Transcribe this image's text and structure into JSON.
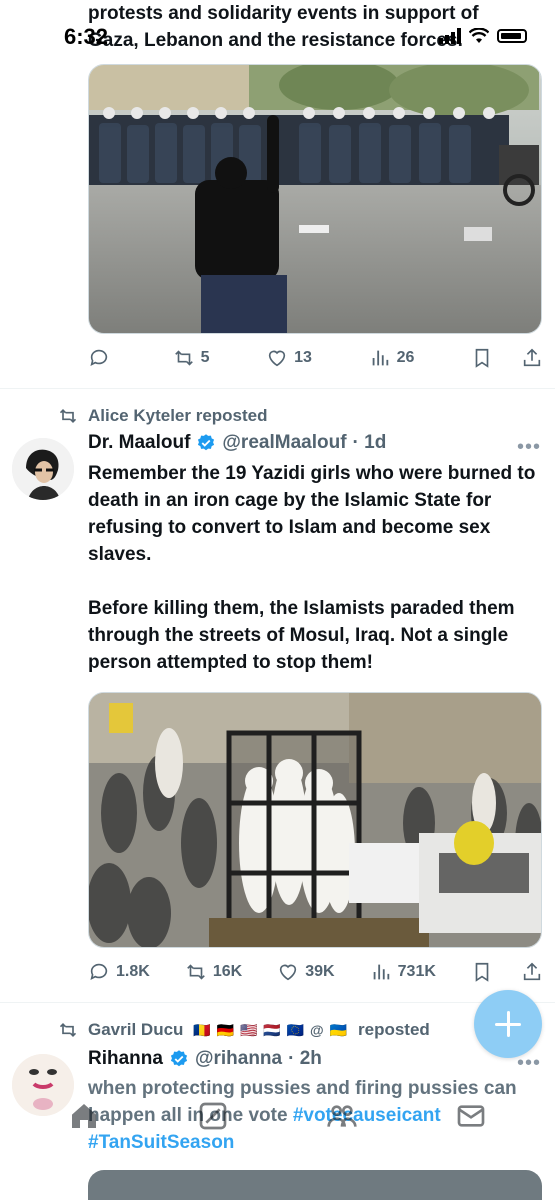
{
  "status": {
    "time": "6:32"
  },
  "tweet1": {
    "text_line1": "protests and solidarity events in support of",
    "text_line2": "Gaza, Lebanon and the resistance forces.",
    "actions": {
      "reply": "",
      "reposts": "5",
      "likes": "13",
      "views": "26"
    }
  },
  "tweet2": {
    "reposted_by": "Alice Kyteler reposted",
    "author": "Dr. Maalouf",
    "handle": "@realMaalouf",
    "time": "· 1d",
    "para1": "Remember the 19 Yazidi girls who were burned to death in an iron cage by the Islamic State for refusing to convert to Islam and become sex slaves.",
    "para2": "Before killing them, the Islamists paraded them through the streets of Mosul, Iraq. Not a single person attempted to stop them!",
    "actions": {
      "replies": "1.8K",
      "reposts": "16K",
      "likes": "39K",
      "views": "731K"
    }
  },
  "tweet3": {
    "reposted_by_name": "Gavril Ducu",
    "reposted_by_flags": "🇷🇴 🇩🇪 🇺🇸 🇳🇱 🇪🇺 @ 🇺🇦",
    "reposted_suffix": "reposted",
    "author": "Rihanna",
    "handle": "@rihanna",
    "time": "· 2h",
    "text_plain": "when protecting pussies and firing pussies can happen all in one vote",
    "hashtag1": "#votecauseicant",
    "hashtag2": "#TanSuitSeason"
  },
  "colors": {
    "accent": "#1d9bf0",
    "verified": "#1d9bf0",
    "muted": "#536471",
    "fab": "#8ecdf5"
  },
  "nav": {
    "items": [
      "home-icon",
      "grok-icon",
      "communities-icon",
      "messages-icon"
    ]
  }
}
